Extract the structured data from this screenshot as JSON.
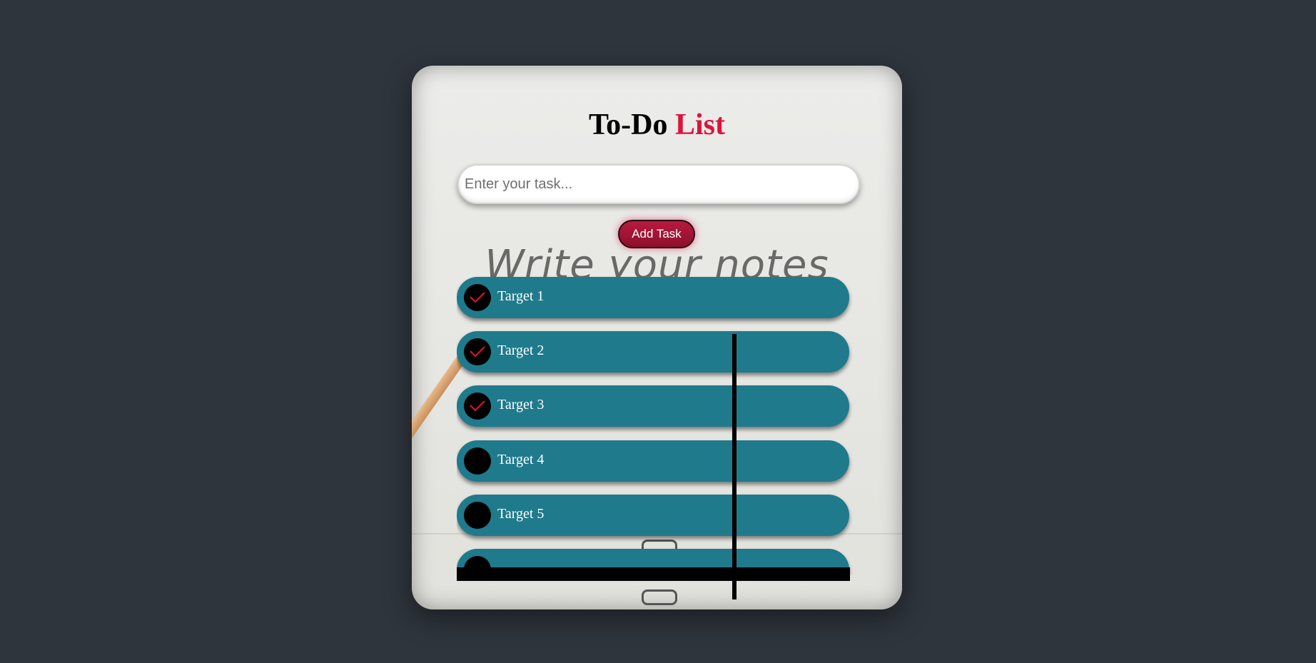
{
  "app": {
    "title_main": "To-Do",
    "title_accent": "List",
    "background_text": "Write your notes"
  },
  "input": {
    "placeholder": "Enter your task...",
    "value": ""
  },
  "add_button": {
    "label": "Add Task"
  },
  "tasks": [
    {
      "label": "Target 1",
      "checked": true
    },
    {
      "label": "Target 2",
      "checked": true
    },
    {
      "label": "Target 3",
      "checked": true
    },
    {
      "label": "Target 4",
      "checked": false
    },
    {
      "label": "Target 5",
      "checked": false
    },
    {
      "label": "",
      "checked": false
    }
  ],
  "colors": {
    "page_bg": "#2f353d",
    "accent": "#dc143c",
    "task_bg": "#1f7a8c",
    "button_bg": "#a0122f"
  },
  "icons": {
    "check": "check-icon"
  }
}
